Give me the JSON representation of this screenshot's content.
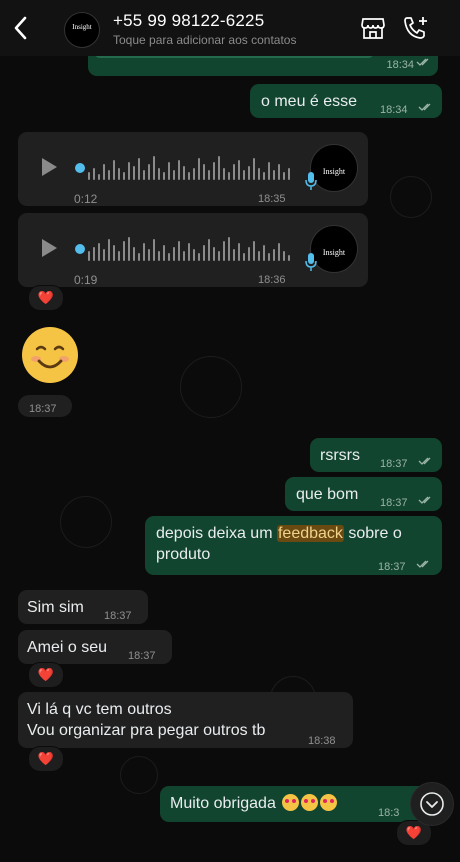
{
  "header": {
    "contact_number": "+55 99 98122-6225",
    "subtitle": "Toque para adicionar aos contatos",
    "avatar_text": "Insight"
  },
  "messages": {
    "m1_time": "18:34",
    "m2_text": "o meu é esse",
    "m2_time": "18:34",
    "audio1": {
      "duration": "0:12",
      "time": "18:35",
      "avatar_text": "Insight"
    },
    "audio2": {
      "duration": "0:19",
      "time": "18:36",
      "avatar_text": "Insight"
    },
    "sticker_time": "18:37",
    "m3_text": "rsrsrs",
    "m3_time": "18:37",
    "m4_text": "que bom",
    "m4_time": "18:37",
    "m5_pre": "depois deixa um ",
    "m5_highlight": "feedback",
    "m5_post": " sobre o",
    "m5_line2": "produto",
    "m5_time": "18:37",
    "m6_text": "Sim sim",
    "m6_time": "18:37",
    "m7_text": "Amei o seu",
    "m7_time": "18:37",
    "m8_line1": "Vi lá q vc tem outros",
    "m8_line2": "Vou organizar pra pegar outros tb",
    "m8_time": "18:38",
    "m9_text": "Muito obrigada",
    "m9_time": "18:3",
    "reaction": "❤️"
  },
  "colors": {
    "outgoing": "#11452f",
    "incoming": "#202020",
    "accent": "#53bdeb",
    "read_ticks": "#9bb3a8"
  }
}
